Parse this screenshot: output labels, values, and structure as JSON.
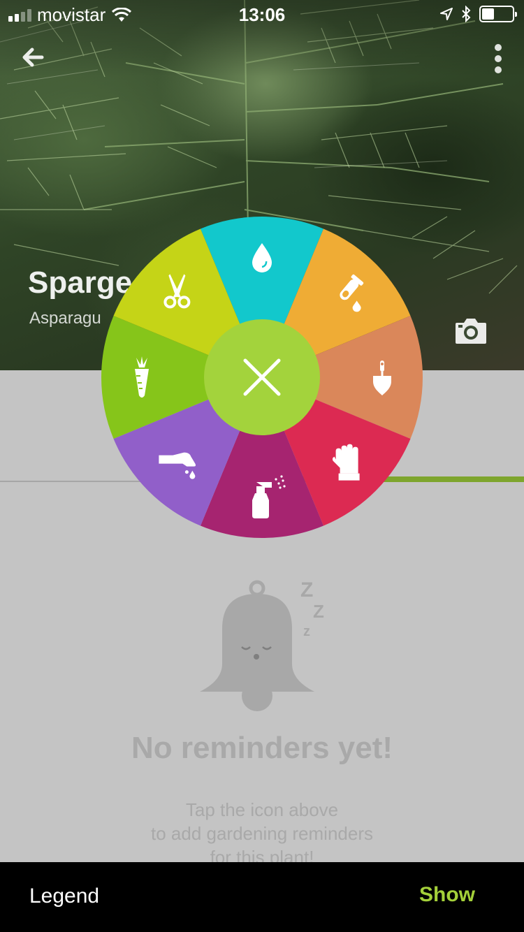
{
  "status_bar": {
    "carrier": "movistar",
    "time": "13:06"
  },
  "plant": {
    "name": "Sparge",
    "latin": "Asparagu"
  },
  "empty_state": {
    "title": "No reminders yet!",
    "subtitle_line1": "Tap the icon above",
    "subtitle_line2": "to add gardening reminders",
    "subtitle_line3": "for this plant!",
    "zzz": [
      "Z",
      "Z",
      "z"
    ]
  },
  "bottom_bar": {
    "legend_label": "Legend",
    "show_label": "Show"
  },
  "reminder_wheel": {
    "segments": [
      {
        "name": "water",
        "icon": "water-drop-icon",
        "color": "#12c8cc"
      },
      {
        "name": "fertilize",
        "icon": "test-tube-icon",
        "color": "#efac35"
      },
      {
        "name": "dig",
        "icon": "trowel-icon",
        "color": "#da875a"
      },
      {
        "name": "gloves",
        "icon": "glove-icon",
        "color": "#dc2a52"
      },
      {
        "name": "spray",
        "icon": "spray-bottle-icon",
        "color": "#a62470"
      },
      {
        "name": "sow",
        "icon": "sowing-hand-icon",
        "color": "#915fc9"
      },
      {
        "name": "harvest",
        "icon": "carrot-icon",
        "color": "#86c51a"
      },
      {
        "name": "prune",
        "icon": "scissors-icon",
        "color": "#c5d417"
      }
    ],
    "center_color": "#a3d33c"
  },
  "colors": {
    "accent": "#7ea52d",
    "show": "#a4d03a",
    "content_bg": "#c4c4c4"
  }
}
